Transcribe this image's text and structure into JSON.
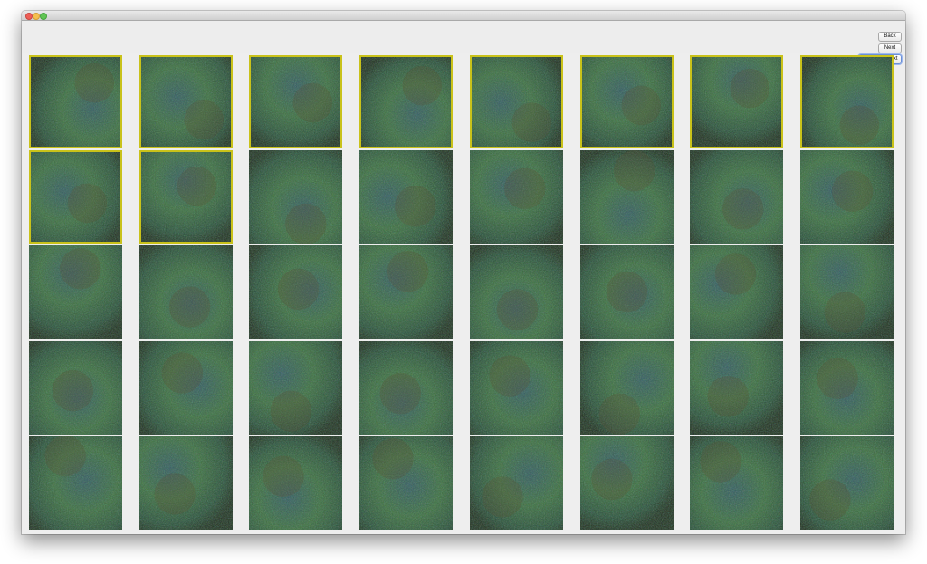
{
  "window": {
    "traffic_lights": [
      "close",
      "minimize",
      "zoom"
    ]
  },
  "toolbar": {
    "back_label": "Back",
    "next_label": "Next",
    "generate_label": "Generate Next"
  },
  "colors": {
    "selection_border": "#c9c21a",
    "texture_base": "#2f5e45",
    "texture_dark": "#1f2a1c",
    "texture_blue": "#3d6f83",
    "texture_green": "#4d8f4f",
    "texture_brown": "#5a4b2e"
  },
  "grid": {
    "rows": 5,
    "columns": 8,
    "tiles": [
      {
        "selected": true
      },
      {
        "selected": true
      },
      {
        "selected": true
      },
      {
        "selected": true
      },
      {
        "selected": true
      },
      {
        "selected": true
      },
      {
        "selected": true
      },
      {
        "selected": true
      },
      {
        "selected": true
      },
      {
        "selected": true
      },
      {
        "selected": false
      },
      {
        "selected": false
      },
      {
        "selected": false
      },
      {
        "selected": false
      },
      {
        "selected": false
      },
      {
        "selected": false
      },
      {
        "selected": false
      },
      {
        "selected": false
      },
      {
        "selected": false
      },
      {
        "selected": false
      },
      {
        "selected": false
      },
      {
        "selected": false
      },
      {
        "selected": false
      },
      {
        "selected": false
      },
      {
        "selected": false
      },
      {
        "selected": false
      },
      {
        "selected": false
      },
      {
        "selected": false
      },
      {
        "selected": false
      },
      {
        "selected": false
      },
      {
        "selected": false
      },
      {
        "selected": false
      },
      {
        "selected": false
      },
      {
        "selected": false
      },
      {
        "selected": false
      },
      {
        "selected": false
      },
      {
        "selected": false
      },
      {
        "selected": false
      },
      {
        "selected": false
      },
      {
        "selected": false
      }
    ]
  }
}
